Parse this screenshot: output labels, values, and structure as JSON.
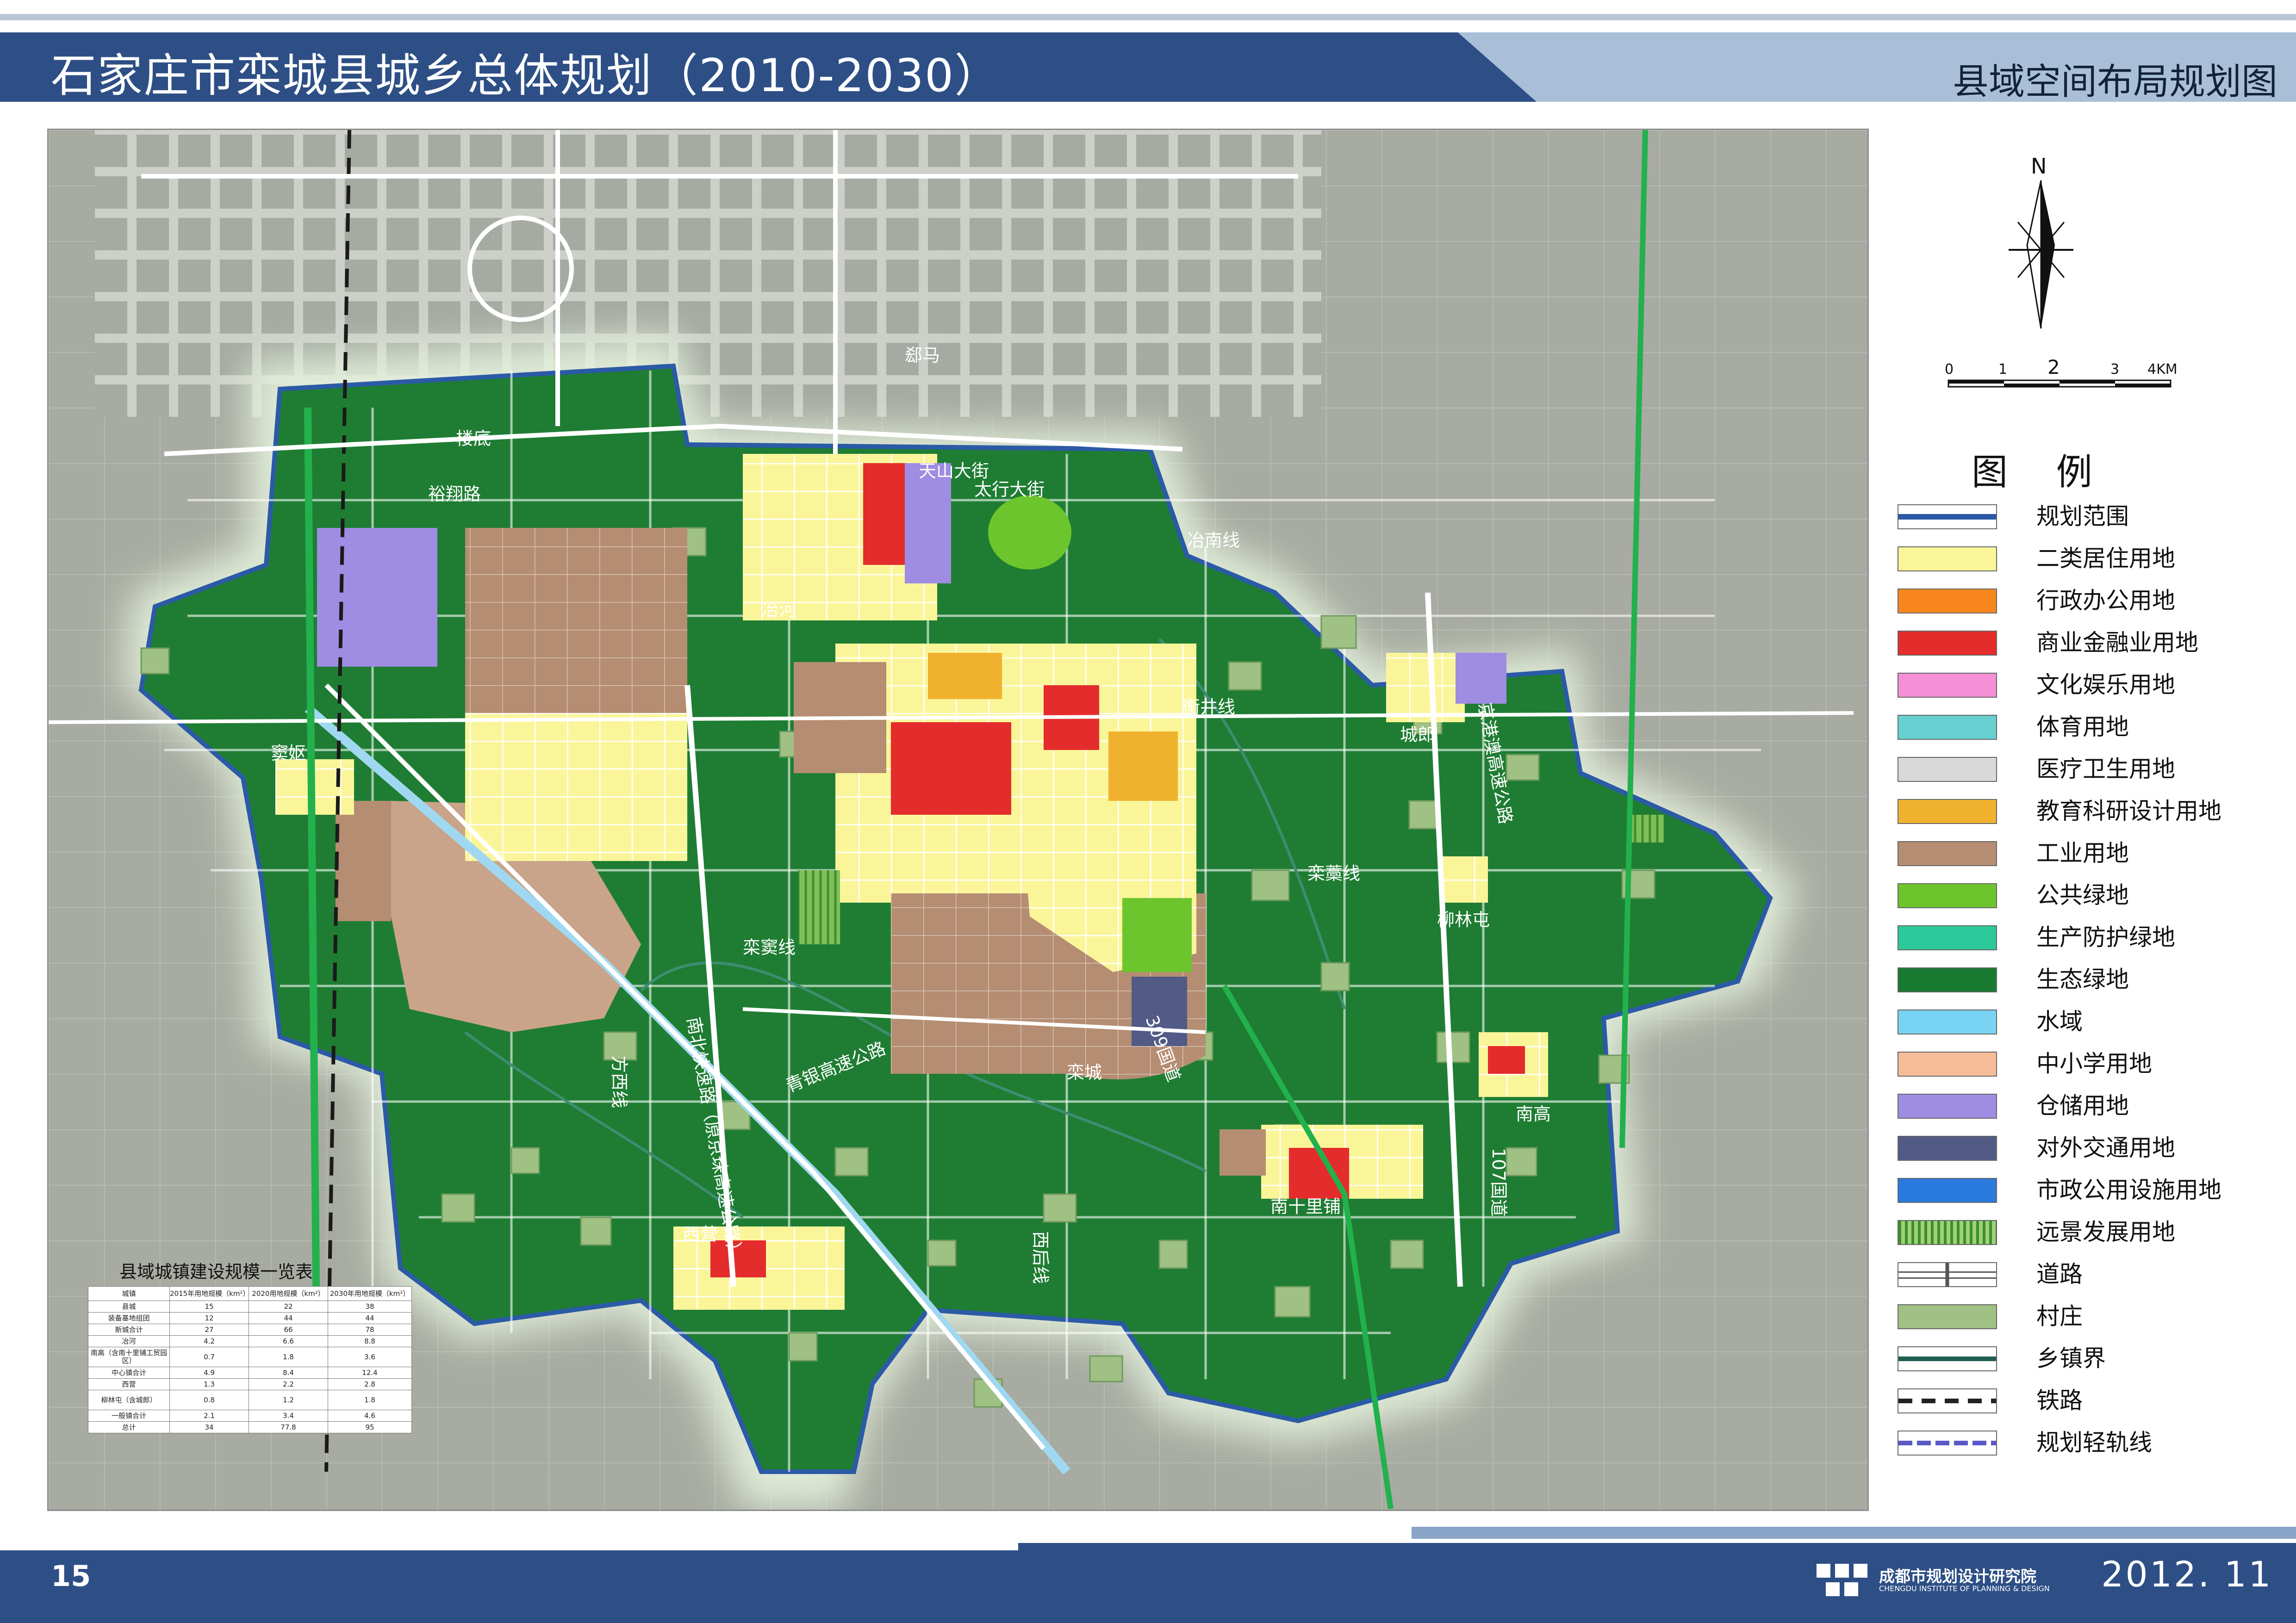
{
  "header": {
    "title": "石家庄市栾城县城乡总体规划（2010-2030）",
    "subtitle": "县域空间布局规划图"
  },
  "map": {
    "place_labels": [
      "郄马",
      "楼底",
      "冶河",
      "窦妪",
      "城郎",
      "柳林屯",
      "栾城",
      "南高",
      "南十里铺",
      "西营"
    ],
    "road_labels": [
      "裕翔路",
      "天山大街",
      "太行大街",
      "冶南线",
      "衡井线",
      "京港澳高速公路",
      "栾藁线",
      "栾窦线",
      "南北快速路（原京珠高速公路）",
      "青银高速公路",
      "309国道",
      "方西线",
      "西后线",
      "107国道"
    ]
  },
  "compass": {
    "north_label": "N"
  },
  "scale_bar": {
    "ticks": [
      "0",
      "1",
      "2",
      "3",
      "4KM"
    ]
  },
  "legend": {
    "title": "图  例",
    "items": [
      {
        "label": "规划范围",
        "icon": "boundary-line-icon",
        "color": "#2b5aa6"
      },
      {
        "label": "二类居住用地",
        "color": "#fbf59a"
      },
      {
        "label": "行政办公用地",
        "color": "#f7861e"
      },
      {
        "label": "商业金融业用地",
        "color": "#e42c2c"
      },
      {
        "label": "文化娱乐用地",
        "color": "#f58fd6"
      },
      {
        "label": "体育用地",
        "color": "#66d1d0"
      },
      {
        "label": "医疗卫生用地",
        "color": "#d9d9d9"
      },
      {
        "label": "教育科研设计用地",
        "color": "#f0b22e"
      },
      {
        "label": "工业用地",
        "color": "#b58d72"
      },
      {
        "label": "公共绿地",
        "color": "#6cc52c"
      },
      {
        "label": "生产防护绿地",
        "color": "#2cc99a"
      },
      {
        "label": "生态绿地",
        "color": "#197a32"
      },
      {
        "label": "水域",
        "color": "#79d4f3"
      },
      {
        "label": "中小学用地",
        "color": "#f6bc98"
      },
      {
        "label": "仓储用地",
        "color": "#9e8de2"
      },
      {
        "label": "对外交通用地",
        "color": "#525a86"
      },
      {
        "label": "市政公用设施用地",
        "color": "#2a79dc"
      },
      {
        "label": "远景发展用地",
        "icon": "hatched-green-icon",
        "color": "#5fb24a"
      },
      {
        "label": "道路",
        "icon": "road-icon",
        "color": "#ffffff"
      },
      {
        "label": "村庄",
        "color": "#9fc183"
      },
      {
        "label": "乡镇界",
        "icon": "township-boundary-icon",
        "color": "#1f5e52"
      },
      {
        "label": "铁路",
        "icon": "railway-icon",
        "color": "#222222"
      },
      {
        "label": "规划轻轨线",
        "icon": "light-rail-icon",
        "color": "#5c57c8"
      }
    ]
  },
  "table": {
    "title": "县域城镇建设规模一览表",
    "headers": [
      "城镇",
      "2015年用地规模（km²）",
      "2020用地规模（km²）",
      "2030年用地规模（km²）"
    ],
    "rows": [
      [
        "县城",
        "15",
        "22",
        "38"
      ],
      [
        "装备基地组团",
        "12",
        "44",
        "44"
      ],
      [
        "新城合计",
        "27",
        "66",
        "78"
      ],
      [
        "冶河",
        "4.2",
        "6.6",
        "8.8"
      ],
      [
        "南高（含南十里铺工贸园区）",
        "0.7",
        "1.8",
        "3.6"
      ],
      [
        "中心镇合计",
        "4.9",
        "8.4",
        "12.4"
      ],
      [
        "西营",
        "1.3",
        "2.2",
        "2.8"
      ],
      [
        "柳林屯（含城郎）",
        "0.8",
        "1.2",
        "1.8"
      ],
      [
        "一般镇合计",
        "2.1",
        "3.4",
        "4.6"
      ],
      [
        "总计",
        "34",
        "77.8",
        "95"
      ]
    ]
  },
  "footer": {
    "page_number": "15",
    "org_cn": "成都市规划设计研究院",
    "org_en": "CHENGDU INSTITUTE OF PLANNING & DESIGN",
    "date": "2012. 11"
  }
}
